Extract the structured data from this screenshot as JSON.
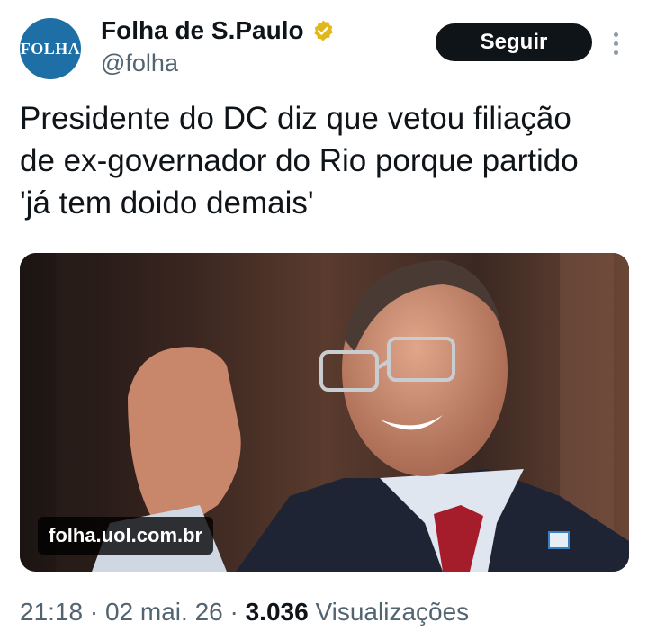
{
  "account": {
    "avatar_text": "FOLHA",
    "display_name": "Folha de S.Paulo",
    "handle": "@folha",
    "verified_icon": "verified-badge-gold",
    "follow_label": "Seguir"
  },
  "tweet": {
    "text": "Presidente do DC diz que vetou filiação\nde ex-governador do Rio porque partido\n'já tem doido demais'"
  },
  "media": {
    "domain": "folha.uol.com.br"
  },
  "meta": {
    "time": "21:18",
    "sep1": " · ",
    "date": "02 mai. 26",
    "sep2": " · ",
    "views_count": "3.036",
    "views_label": "Visualizações"
  },
  "colors": {
    "accent_dark": "#0f1419",
    "muted": "#536471",
    "avatar_bg": "#1d6fa5",
    "verified": "#e2b719"
  }
}
